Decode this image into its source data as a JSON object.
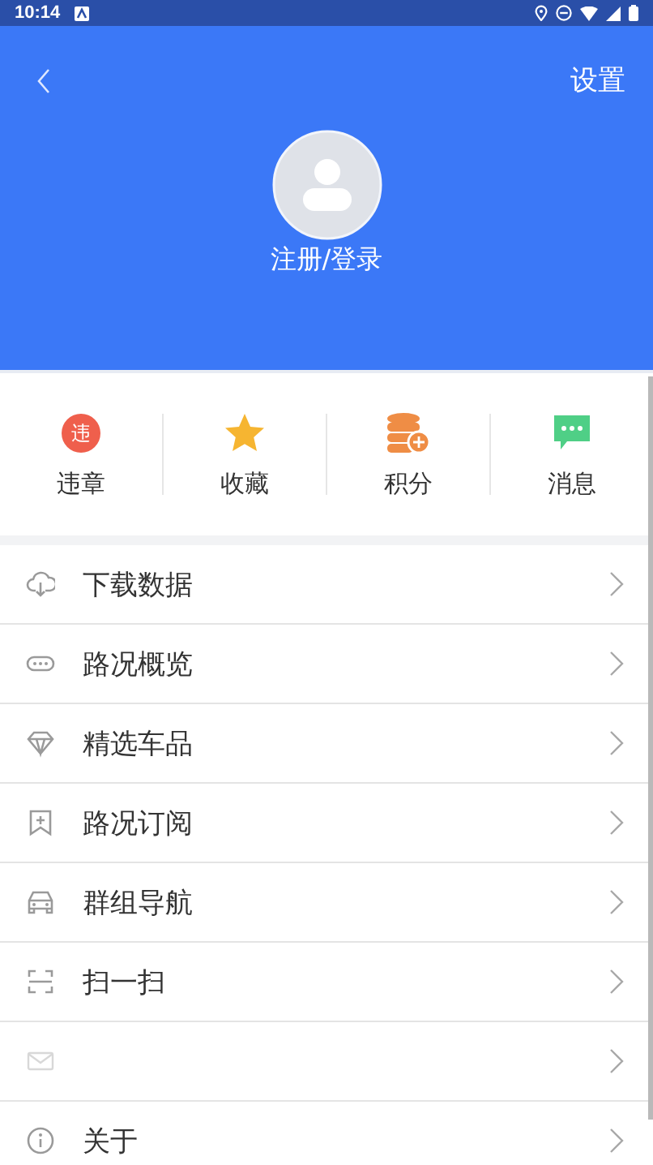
{
  "status_bar": {
    "time": "10:14"
  },
  "header": {
    "settings": "设置",
    "login": "注册/登录"
  },
  "quick_actions": [
    {
      "label": "违章",
      "badge": "违"
    },
    {
      "label": "收藏"
    },
    {
      "label": "积分"
    },
    {
      "label": "消息"
    }
  ],
  "menu": [
    {
      "kind": "entry",
      "label": "下载数据"
    },
    {
      "kind": "entry",
      "label": "路况概览"
    },
    {
      "kind": "entry",
      "label": "精选车品"
    },
    {
      "kind": "entry",
      "label": "路况订阅"
    },
    {
      "kind": "entry",
      "label": "群组导航"
    },
    {
      "kind": "entry",
      "label": "扫一扫"
    },
    {
      "kind": "blank"
    },
    {
      "kind": "entry",
      "label": "关于"
    }
  ]
}
